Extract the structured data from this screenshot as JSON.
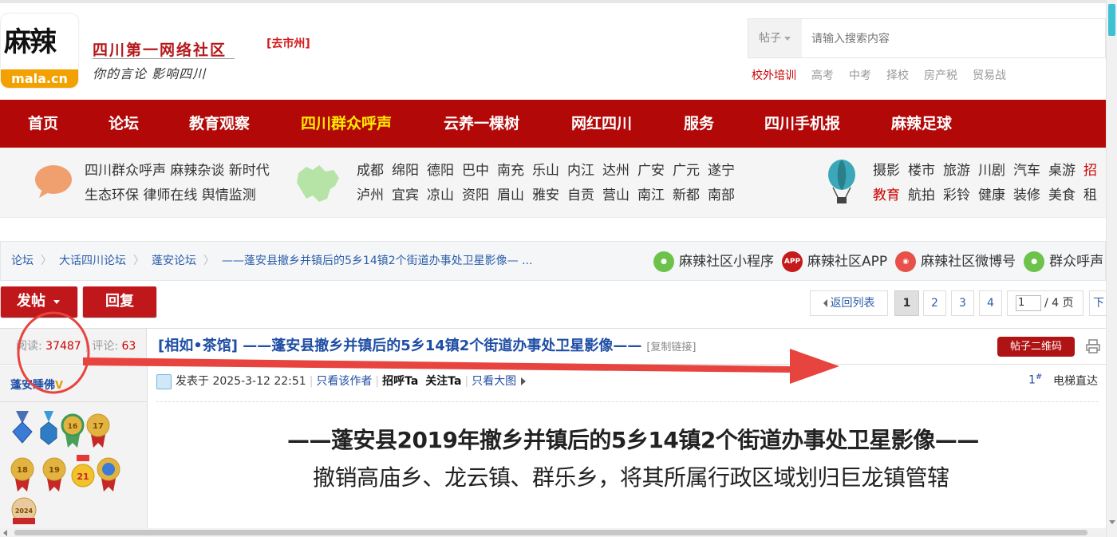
{
  "header": {
    "logo_cn": "麻辣",
    "logo_en": "mala.cn",
    "title": "四川第一网络社区",
    "slogan": "你的言论 影响四川",
    "city_link": "[去市州]",
    "search": {
      "type_label": "帖子",
      "placeholder": "请输入搜索内容"
    },
    "hot_links": [
      "校外培训",
      "高考",
      "中考",
      "择校",
      "房产税",
      "贸易战"
    ]
  },
  "nav": {
    "items": [
      {
        "label": "首页"
      },
      {
        "label": "论坛"
      },
      {
        "label": "教育观察"
      },
      {
        "label": "四川群众呼声",
        "active": true
      },
      {
        "label": "云养一棵树"
      },
      {
        "label": "网红四川"
      },
      {
        "label": "服务"
      },
      {
        "label": "四川手机报"
      },
      {
        "label": "麻辣足球"
      }
    ]
  },
  "channels": {
    "group1": [
      "四川群众呼声 麻辣杂谈 新时代",
      "生态环保 律师在线 舆情监测"
    ],
    "cities_row1": [
      "成都",
      "绵阳",
      "德阳",
      "巴中",
      "南充",
      "乐山",
      "内江",
      "达州",
      "广安",
      "广元",
      "遂宁"
    ],
    "cities_row2": [
      "泸州",
      "宜宾",
      "凉山",
      "资阳",
      "眉山",
      "雅安",
      "自贡",
      "营山",
      "南江",
      "新都",
      "南部"
    ],
    "cats_row1": [
      "摄影",
      "楼市",
      "旅游",
      "川剧",
      "汽车",
      "桌游",
      "招"
    ],
    "cats_row2": [
      "教育",
      "航拍",
      "彩铃",
      "健康",
      "装修",
      "美食",
      "租"
    ]
  },
  "breadcrumb": {
    "items": [
      "论坛",
      "大话四川论坛",
      "蓬安论坛",
      "——蓬安县撤乡并镇后的5乡14镇2个街道办事处卫星影像— ..."
    ],
    "apps": [
      "麻辣社区小程序",
      "麻辣社区APP",
      "麻辣社区微博号",
      "群众呼声"
    ]
  },
  "actions": {
    "post": "发帖",
    "reply": "回复",
    "back_to_list": "返回列表",
    "pages": [
      "1",
      "2",
      "3",
      "4"
    ],
    "current_page": "1",
    "page_input": "1",
    "total_pages": "/ 4 页",
    "next_label": "下"
  },
  "thread": {
    "reads_label": "阅读:",
    "reads": "37487",
    "comments_label": "评论:",
    "comments": "63",
    "title": "[相如•茶馆] ——蓬安县撤乡并镇后的5乡14镇2个街道办事处卫星影像——",
    "copy_link": "[复制链接]",
    "qr_button": "帖子二维码"
  },
  "post": {
    "author": "蓬安睡佛",
    "author_badge": "V",
    "posted": "发表于 2025-3-12 22:51",
    "only_author": "只看该作者",
    "greet": "招呼Ta",
    "follow": "关注Ta",
    "big_image": "只看大图",
    "floor": "1",
    "floor_mark": "#",
    "elevator": "电梯直达",
    "medal_labels": [
      "16",
      "17",
      "18",
      "19",
      "21",
      "2024"
    ],
    "heading": "——蓬安县2019年撤乡并镇后的5乡14镇2个街道办事处卫星影像——",
    "subheading": "撤销高庙乡、龙云镇、群乐乡，将其所属行政区域划归巨龙镇管辖"
  },
  "colors": {
    "brand_red": "#b30808",
    "nav_active": "#ffeb00",
    "link_blue": "#1f4ea5",
    "annotation": "#e8443f"
  }
}
